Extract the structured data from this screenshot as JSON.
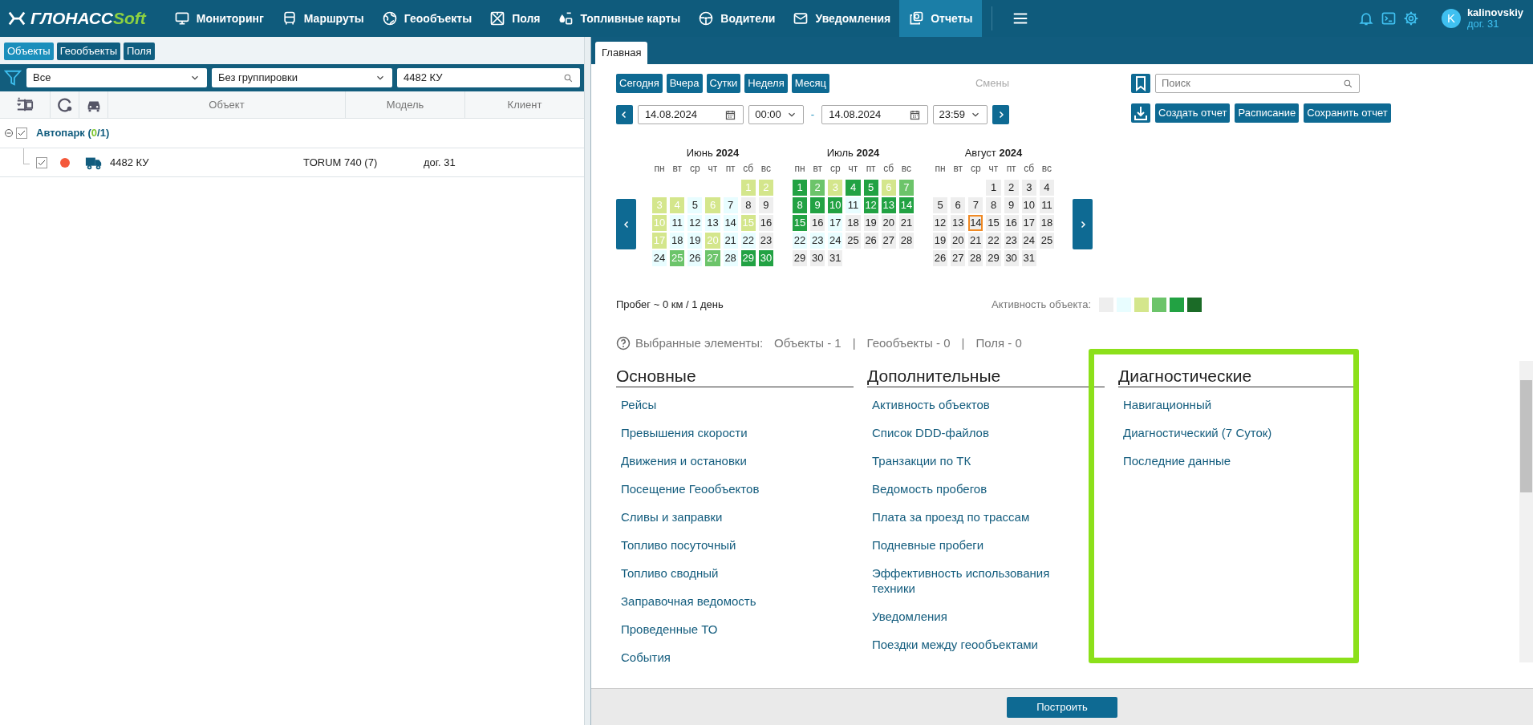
{
  "header": {
    "logo_main": "ГЛОНАСС",
    "logo_accent": "Soft",
    "nav": [
      {
        "label": "Мониторинг",
        "selected": false
      },
      {
        "label": "Маршруты",
        "selected": false
      },
      {
        "label": "Геообъекты",
        "selected": false
      },
      {
        "label": "Поля",
        "selected": false
      },
      {
        "label": "Топливные карты",
        "selected": false
      },
      {
        "label": "Водители",
        "selected": false
      },
      {
        "label": "Уведомления",
        "selected": false
      },
      {
        "label": "Отчеты",
        "selected": true
      }
    ],
    "user": {
      "initial": "K",
      "name": "kalinovskiy",
      "account": "дог. 31"
    }
  },
  "left_panel": {
    "tabs": [
      {
        "label": "Объекты",
        "selected": true
      },
      {
        "label": "Геообъекты",
        "selected": false
      },
      {
        "label": "Поля",
        "selected": false
      }
    ],
    "filter": {
      "value": "Все"
    },
    "grouping": {
      "value": "Без группировки"
    },
    "search": {
      "value": "4482 КУ"
    },
    "columns": [
      "Объект",
      "Модель",
      "Клиент"
    ],
    "group": {
      "name": "Автопарк",
      "count_open": "(",
      "active": "0",
      "count_rest": "/1)",
      "expanded": true,
      "checked": true
    },
    "rows": [
      {
        "checked": true,
        "color": "#f4583a",
        "name": "4482 КУ",
        "model": "TORUM 740 (7)",
        "client": "дог. 31"
      }
    ]
  },
  "report": {
    "tabs": [
      {
        "label": "Главная",
        "selected": true
      }
    ],
    "quick_periods": [
      "Сегодня",
      "Вчера",
      "Сутки",
      "Неделя",
      "Месяц"
    ],
    "shifts": "Смены",
    "from_date": "14.08.2024",
    "from_time": "00:00",
    "separator": "-",
    "to_date": "14.08.2024",
    "to_time": "23:59",
    "search": {
      "placeholder": "Поиск"
    },
    "actions": [
      "Создать отчет",
      "Расписание",
      "Сохранить отчет"
    ],
    "months": [
      {
        "name": "Июнь",
        "year": "2024",
        "weekdays": [
          "пн",
          "вт",
          "ср",
          "чт",
          "пт",
          "сб",
          "вс"
        ],
        "weeks": [
          [
            {
              "kind": "blank"
            },
            {
              "kind": "blank"
            },
            {
              "kind": "blank"
            },
            {
              "kind": "blank"
            },
            {
              "kind": "blank"
            },
            {
              "day": "1",
              "color": "#d4e68c"
            },
            {
              "day": "2",
              "color": "#d4e68c"
            }
          ],
          [
            {
              "day": "3",
              "color": "#d4e68c"
            },
            {
              "day": "4",
              "color": "#d4e68c"
            },
            {
              "day": "5",
              "color": "#e8fdff"
            },
            {
              "day": "6",
              "color": "#d4e68c"
            },
            {
              "day": "7",
              "color": "#e8fdff"
            },
            {
              "day": "8",
              "color": "#eeeeee"
            },
            {
              "day": "9",
              "color": "#eeeeee"
            }
          ],
          [
            {
              "day": "10",
              "color": "#d4e68c"
            },
            {
              "day": "11",
              "color": "#e8fdff"
            },
            {
              "day": "12",
              "color": "#e8fdff"
            },
            {
              "day": "13",
              "color": "#e8fdff"
            },
            {
              "day": "14",
              "color": "#e8fdff"
            },
            {
              "day": "15",
              "color": "#d4e68c"
            },
            {
              "day": "16",
              "color": "#eeeeee"
            }
          ],
          [
            {
              "day": "17",
              "color": "#d4e68c"
            },
            {
              "day": "18",
              "color": "#e8fdff"
            },
            {
              "day": "19",
              "color": "#e8fdff"
            },
            {
              "day": "20",
              "color": "#d4e68c"
            },
            {
              "day": "21",
              "color": "#e8fdff"
            },
            {
              "day": "22",
              "color": "#e8fdff"
            },
            {
              "day": "23",
              "color": "#eeeeee"
            }
          ],
          [
            {
              "day": "24",
              "color": "#e8fdff"
            },
            {
              "day": "25",
              "color": "#6cc46a"
            },
            {
              "day": "26",
              "color": "#e8fdff"
            },
            {
              "day": "27",
              "color": "#6cc46a"
            },
            {
              "day": "28",
              "color": "#e8fdff"
            },
            {
              "day": "29",
              "color": "#22a243"
            },
            {
              "day": "30",
              "color": "#22a243"
            }
          ]
        ]
      },
      {
        "name": "Июль",
        "year": "2024",
        "weekdays": [
          "пн",
          "вт",
          "ср",
          "чт",
          "пт",
          "сб",
          "вс"
        ],
        "weeks": [
          [
            {
              "day": "1",
              "color": "#22a243"
            },
            {
              "day": "2",
              "color": "#6cc46a"
            },
            {
              "day": "3",
              "color": "#d4e68c"
            },
            {
              "day": "4",
              "color": "#22a243"
            },
            {
              "day": "5",
              "color": "#22a243"
            },
            {
              "day": "6",
              "color": "#d4e68c"
            },
            {
              "day": "7",
              "color": "#6cc46a"
            }
          ],
          [
            {
              "day": "8",
              "color": "#22a243"
            },
            {
              "day": "9",
              "color": "#22a243"
            },
            {
              "day": "10",
              "color": "#22a243"
            },
            {
              "day": "11",
              "color": "#e8fdff"
            },
            {
              "day": "12",
              "color": "#22a243"
            },
            {
              "day": "13",
              "color": "#22a243"
            },
            {
              "day": "14",
              "color": "#22a243"
            }
          ],
          [
            {
              "day": "15",
              "color": "#22a243"
            },
            {
              "day": "16",
              "color": "#eeeeee"
            },
            {
              "day": "17",
              "color": "#e8fdff"
            },
            {
              "day": "18",
              "color": "#eeeeee"
            },
            {
              "day": "19",
              "color": "#eeeeee"
            },
            {
              "day": "20",
              "color": "#eeeeee"
            },
            {
              "day": "21",
              "color": "#eeeeee"
            }
          ],
          [
            {
              "day": "22",
              "color": "#e8fdff"
            },
            {
              "day": "23",
              "color": "#e8fdff"
            },
            {
              "day": "24",
              "color": "#e8fdff"
            },
            {
              "day": "25",
              "color": "#eeeeee"
            },
            {
              "day": "26",
              "color": "#eeeeee"
            },
            {
              "day": "27",
              "color": "#eeeeee"
            },
            {
              "day": "28",
              "color": "#eeeeee"
            }
          ],
          [
            {
              "day": "29",
              "color": "#eeeeee"
            },
            {
              "day": "30",
              "color": "#eeeeee"
            },
            {
              "day": "31",
              "color": "#eeeeee"
            },
            {
              "kind": "blank"
            },
            {
              "kind": "blank"
            },
            {
              "kind": "blank"
            },
            {
              "kind": "blank"
            }
          ]
        ]
      },
      {
        "name": "Август",
        "year": "2024",
        "weekdays": [
          "пн",
          "вт",
          "ср",
          "чт",
          "пт",
          "сб",
          "вс"
        ],
        "weeks": [
          [
            {
              "kind": "blank"
            },
            {
              "kind": "blank"
            },
            {
              "kind": "blank"
            },
            {
              "day": "1",
              "color": "#eeeeee"
            },
            {
              "day": "2",
              "color": "#eeeeee"
            },
            {
              "day": "3",
              "color": "#eeeeee"
            },
            {
              "day": "4",
              "color": "#eeeeee"
            }
          ],
          [
            {
              "day": "5",
              "color": "#eeeeee"
            },
            {
              "day": "6",
              "color": "#eeeeee"
            },
            {
              "day": "7",
              "color": "#eeeeee"
            },
            {
              "day": "8",
              "color": "#eeeeee"
            },
            {
              "day": "9",
              "color": "#eeeeee"
            },
            {
              "day": "10",
              "color": "#eeeeee"
            },
            {
              "day": "11",
              "color": "#eeeeee"
            }
          ],
          [
            {
              "day": "12",
              "color": "#eeeeee"
            },
            {
              "day": "13",
              "color": "#eeeeee"
            },
            {
              "day": "14",
              "color": "#eeeeee",
              "selected": true
            },
            {
              "day": "15",
              "color": "#eeeeee"
            },
            {
              "day": "16",
              "color": "#eeeeee"
            },
            {
              "day": "17",
              "color": "#eeeeee"
            },
            {
              "day": "18",
              "color": "#eeeeee"
            }
          ],
          [
            {
              "day": "19",
              "color": "#eeeeee"
            },
            {
              "day": "20",
              "color": "#eeeeee"
            },
            {
              "day": "21",
              "color": "#eeeeee"
            },
            {
              "day": "22",
              "color": "#eeeeee"
            },
            {
              "day": "23",
              "color": "#eeeeee"
            },
            {
              "day": "24",
              "color": "#eeeeee"
            },
            {
              "day": "25",
              "color": "#eeeeee"
            }
          ],
          [
            {
              "day": "26",
              "color": "#eeeeee"
            },
            {
              "day": "27",
              "color": "#eeeeee"
            },
            {
              "day": "28",
              "color": "#eeeeee"
            },
            {
              "day": "29",
              "color": "#eeeeee"
            },
            {
              "day": "30",
              "color": "#eeeeee"
            },
            {
              "day": "31",
              "color": "#eeeeee"
            },
            {
              "kind": "blank"
            }
          ]
        ]
      }
    ],
    "mileage": "Пробег ~ 0 км / 1 день",
    "activity_label": "Активность объекта:",
    "activity_legend": [
      {
        "color": "#eeeeee"
      },
      {
        "color": "#e8fdff"
      },
      {
        "color": "#d4e68c"
      },
      {
        "color": "#6cc46a"
      },
      {
        "color": "#22a243"
      },
      {
        "color": "#1b6b27"
      }
    ],
    "selected_label": "Выбранные элементы:",
    "selected_items": [
      "Объекты - 1",
      "Геообъекты - 0",
      "Поля - 0"
    ],
    "selected_separator": "|",
    "groups": [
      {
        "title": "Основные",
        "highlighted": false,
        "items": [
          "Рейсы",
          "Превышения скорости",
          "Движения и остановки",
          "Посещение Геообъектов",
          "Сливы и заправки",
          "Топливо посуточный",
          "Топливо сводный",
          "Заправочная ведомость",
          "Проведенные ТО",
          "События"
        ]
      },
      {
        "title": "Дополнительные",
        "highlighted": false,
        "items": [
          "Активность объектов",
          "Список DDD-файлов",
          "Транзакции по ТК",
          "Ведомость пробегов",
          "Плата за проезд по трассам",
          "Подневные пробеги",
          "Эффективность использования техники",
          "Уведомления",
          "Поездки между геообъектами"
        ]
      },
      {
        "title": "Диагностические",
        "highlighted": true,
        "items": [
          "Навигационный",
          "Диагностический (7 Суток)",
          "Последние данные"
        ]
      }
    ],
    "build_button": "Построить"
  }
}
